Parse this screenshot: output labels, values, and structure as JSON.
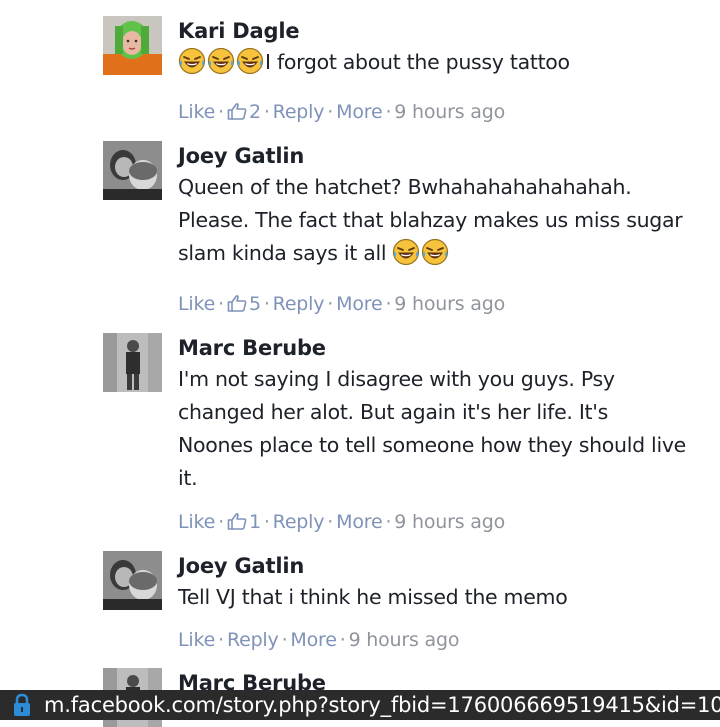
{
  "comments": [
    {
      "author": "Kari Dagle",
      "text": "I forgot about the pussy tattoo",
      "like_label": "Like",
      "like_count": "2",
      "reply_label": "Reply",
      "more_label": "More",
      "time": "9 hours ago"
    },
    {
      "author": "Joey Gatlin",
      "text_lines": [
        "Queen of the hatchet? Bwhahahahahahahah.",
        "Please. The fact that blahzay makes us miss sugar",
        "slam kinda says it all"
      ],
      "like_label": "Like",
      "like_count": "5",
      "reply_label": "Reply",
      "more_label": "More",
      "time": "9 hours ago"
    },
    {
      "author": "Marc Berube",
      "text_lines": [
        "I'm not saying I disagree with you guys. Psy",
        "changed her alot. But again it's her life. It's",
        "Noones place to tell someone how they should live",
        "it."
      ],
      "like_label": "Like",
      "like_count": "1",
      "reply_label": "Reply",
      "more_label": "More",
      "time": "9 hours ago"
    },
    {
      "author": "Joey Gatlin",
      "text": "Tell VJ that i think he missed the memo",
      "like_label": "Like",
      "reply_label": "Reply",
      "more_label": "More",
      "time": "9 hours ago"
    },
    {
      "author": "Marc Berube"
    }
  ],
  "address_bar": {
    "url": "m.facebook.com/story.php?story_fbid=176006669519415&id=10",
    "icon": "lock-icon"
  },
  "colors": {
    "link": "#7f93b8",
    "meta": "#90949c",
    "address_bar_bg": "#2b2b2b",
    "lock": "#2d8cd6"
  }
}
